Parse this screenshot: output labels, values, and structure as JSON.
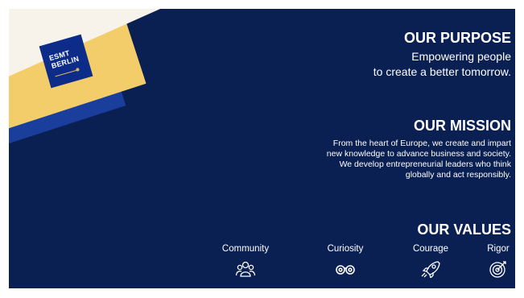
{
  "logo": {
    "line1": "ESMT",
    "line2": "BERLIN"
  },
  "purpose": {
    "title": "OUR PURPOSE",
    "line1": "Empowering people",
    "line2": "to create a better tomorrow."
  },
  "mission": {
    "title": "OUR MISSION",
    "lines": [
      "From the heart of Europe, we create and impart",
      "new knowledge to advance business and society.",
      "We develop entrepreneurial leaders who think",
      "globally and act responsibly."
    ]
  },
  "values": {
    "title": "OUR VALUES",
    "items": [
      {
        "label": "Community",
        "icon": "people-icon"
      },
      {
        "label": "Curiosity",
        "icon": "binoculars-icon"
      },
      {
        "label": "Courage",
        "icon": "rocket-icon"
      },
      {
        "label": "Rigor",
        "icon": "target-icon"
      }
    ]
  },
  "colors": {
    "background": "#0a1f52",
    "accent_yellow": "#f2cd6a",
    "accent_blue": "#1a3e9c",
    "cream": "#f8f3ea",
    "logo_blue": "#0d2c8a"
  }
}
